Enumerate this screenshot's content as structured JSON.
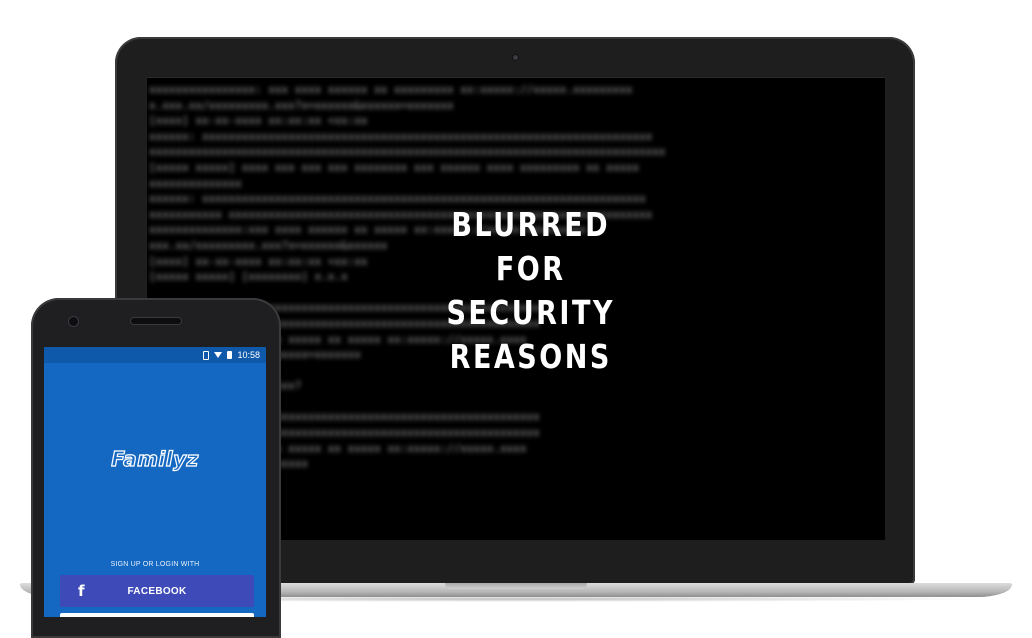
{
  "laptop": {
    "overlay_lines": [
      "BLURRED",
      "FOR",
      "SECURITY",
      "REASONS"
    ],
    "terminal_lines": [
      "xxxxxxxxxxxxxxxx:  xxx xxxx xxxxxx xx xxxxxxxxx  xx:xxxxx://xxxxx.xxxxxxxxx",
      "x.xxx.xx/xxxxxxxxx.xxx?x=xxxxxx&xxxxxx=xxxxxxx",
      "[xxxx]  xx-xx-xxxx xx:xx:xx +xx:xx",
      "xxxxxx: xxxxxxxxxxxxxxxxxxxxxxxxxxxxxxxxxxxxxxxxxxxxxxxxxxxxxxxxxxxxxxxxxxxx",
      "xxxxxxxxxxxxxxxxxxxxxxxxxxxxxxxxxxxxxxxxxxxxxxxxxxxxxxxxxxxxxxxxxxxxxxxxxxxxxx",
      "[xxxxx xxxxx] xxxx xxx xxx xxx xxxxxxxx xxx xxxxxx xxxx xxxxxxxxx xx xxxxx",
      "xxxxxxxxxxxxxx",
      "xxxxxx: xxxxxxxxxxxxxxxxxxxxxxxxxxxxxxxxxxxxxxxxxxxxxxxxxxxxxxxxxxxxxxxxxxx",
      "xxxxxxxxxxx  xxxxxxxxxxxxxxxxxxxxxxxxxxxxxxxxxxxxxxxxxxxxxxxxxxxxxxxxxxxxxxxx",
      "xxxxxxxxxxxxxx:xxx xxxx xxxxxx  xx  xxxxx     xx:xxxxx://xxxxx.xxxxxxxxx",
      "xxx.xx/xxxxxxxxx.xxx?x=xxxxxx&xxxxxx",
      "[xxxx]  xx-xx-xxxx xx:xx:xx +xx:xx",
      "[xxxxx xxxxx] [xxxxxxxx] x.x.x",
      "",
      "                xxxxxxxxxxxxxxxxxxxxxxxxxxxxxxxxxxxxxxxxxxxxxxxxxxxxxxxxxxx",
      "                xxxxxxxxxxxxxxxxxxxxxxxxxxxxxxxxxxxxxxxxxxxxxxxxxxxxxxxxxxx",
      "                xxxxxxxxxxxxxxxxx xx xxxxx xx xxxxx xx:xxxxx://xxxxx.xxxx",
      "                xxxx.xxx?x=xxxxxx&xxxxxx=xxxxxxx",
      "                xx:xx",
      "                xxxx xxxx  xxx xxx xxxx?",
      "                xx",
      "                xxxxxxxxxxxxxxxxxxxxxxxxxxxxxxxxxxxxxxxxxxxxxxxxxxxxxxxxxxx",
      "                xxxxxxxxxxxxxxxxxxxxxxxxxxxxxxxxxxxxxxxxxxxxxxxxxxxxxxxxxxx",
      "                xxxxxxxxxxxxxxxxx xx xxxxx xx xxxxx xx:xxxxx://xxxxx.xxxx",
      "                xxxx.xxx?x=xxxxxx&xxxxxx",
      "                 xx:xx:xx +xx:xx"
    ]
  },
  "phone": {
    "status_bar": {
      "time": "10:58"
    },
    "app_name": "Familyz",
    "signup_label": "SIGN UP OR LOGIN WITH",
    "facebook_icon": "f",
    "facebook_button": "FACEBOOK"
  },
  "colors": {
    "phone_screen": "#1568c2",
    "facebook_button": "#3d4ab8",
    "laptop_bezel": "#1e1e1f"
  }
}
